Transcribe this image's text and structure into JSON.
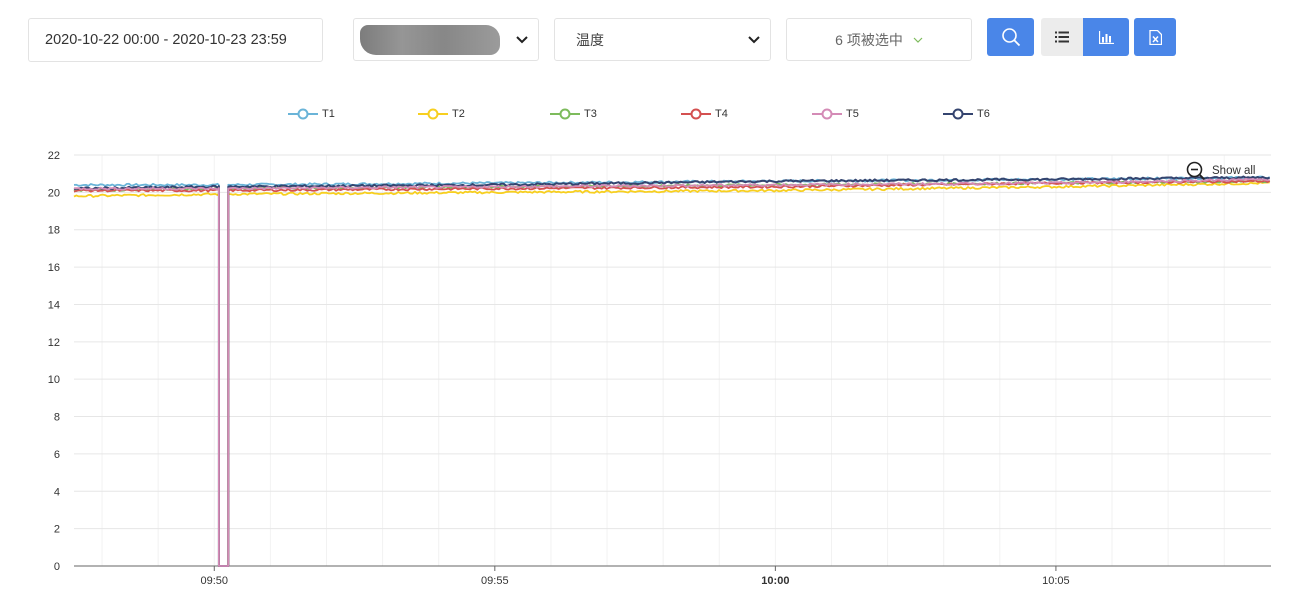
{
  "toolbar": {
    "date_range": "2020-10-22 00:00 - 2020-10-23 23:59",
    "metric": "温度",
    "multi_select": "6 项被选中",
    "icons": {
      "search": "search-icon",
      "list": "list-icon",
      "chart": "bar-chart-icon",
      "excel": "excel-export-icon",
      "device_chevron": "chevron-down-icon",
      "metric_chevron": "chevron-down-icon",
      "multi_chevron": "chevron-down-icon"
    }
  },
  "show_all": "Show all",
  "colors": {
    "T1": "#6ab4d8",
    "T2": "#f7cf1f",
    "T3": "#7dbb5c",
    "T4": "#d45050",
    "T5": "#d48bb6",
    "T6": "#34446f",
    "accent": "#4a86e8"
  },
  "chart_data": {
    "type": "line",
    "x_ticks": [
      "09:50",
      "09:55",
      "10:00",
      "10:05"
    ],
    "y_ticks": [
      "0",
      "2",
      "4",
      "6",
      "8",
      "10",
      "12",
      "14",
      "16",
      "18",
      "20",
      "22"
    ],
    "ylim": [
      0,
      22
    ],
    "xlim_minutes": [
      "09:47:30",
      "10:08:50"
    ],
    "legend": [
      "T1",
      "T2",
      "T3",
      "T4",
      "T5",
      "T6"
    ],
    "legend_position": "top",
    "grid": true,
    "series": [
      {
        "name": "T1",
        "x": [
          "09:47:30",
          "09:50",
          "09:55",
          "10:00",
          "10:05",
          "10:08:50"
        ],
        "values": [
          20.4,
          20.4,
          20.5,
          20.6,
          20.7,
          20.8
        ]
      },
      {
        "name": "T2",
        "x": [
          "09:47:30",
          "09:50",
          "09:55",
          "10:00",
          "10:05",
          "10:08:50"
        ],
        "values": [
          19.8,
          19.9,
          20.0,
          20.1,
          20.3,
          20.5
        ]
      },
      {
        "name": "T3",
        "x": [
          "09:47:30",
          "09:50",
          "09:55",
          "10:00",
          "10:05",
          "10:08:50"
        ],
        "values": [
          20.1,
          20.2,
          20.3,
          20.4,
          20.5,
          20.6
        ]
      },
      {
        "name": "T4",
        "x": [
          "09:47:30",
          "09:50",
          "09:55",
          "10:00",
          "10:05",
          "10:08:50"
        ],
        "values": [
          20.1,
          20.1,
          20.2,
          20.3,
          20.5,
          20.6
        ]
      },
      {
        "name": "T5",
        "x": [
          "09:47:30",
          "09:50",
          "09:55",
          "10:00",
          "10:05",
          "10:08:50"
        ],
        "values": [
          20.2,
          20.2,
          20.3,
          20.4,
          20.5,
          20.7
        ]
      },
      {
        "name": "T6",
        "x": [
          "09:47:30",
          "09:50",
          "09:55",
          "10:00",
          "10:05",
          "10:08:50"
        ],
        "values": [
          20.2,
          20.3,
          20.4,
          20.6,
          20.7,
          20.8
        ]
      }
    ],
    "annotation": "drop to 0 at 09:50:10 on all series"
  }
}
